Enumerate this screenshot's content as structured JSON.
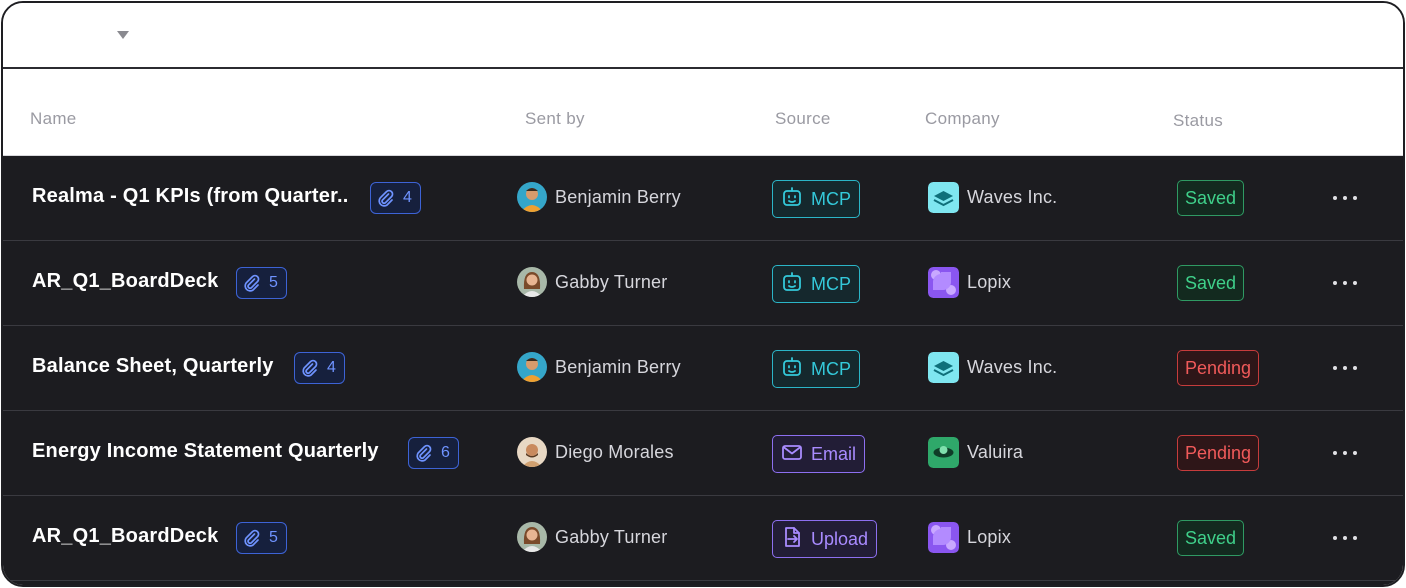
{
  "columns": {
    "name": "Name",
    "sent_by": "Sent by",
    "source": "Source",
    "company": "Company",
    "status": "Status"
  },
  "rows": [
    {
      "name": "Realma - Q1 KPIs (from Quarter..",
      "attachments": "4",
      "sender": "Benjamin Berry",
      "avatar": "avatar-benjamin",
      "source": "MCP",
      "source_icon": "robot-icon",
      "company": "Waves Inc.",
      "company_logo": "waves-logo",
      "status": "Saved"
    },
    {
      "name": "AR_Q1_BoardDeck",
      "attachments": "5",
      "sender": "Gabby Turner",
      "avatar": "avatar-gabby",
      "source": "MCP",
      "source_icon": "robot-icon",
      "company": "Lopix",
      "company_logo": "lopix-logo",
      "status": "Saved"
    },
    {
      "name": "Balance Sheet, Quarterly",
      "attachments": "4",
      "sender": "Benjamin Berry",
      "avatar": "avatar-benjamin",
      "source": "MCP",
      "source_icon": "robot-icon",
      "company": "Waves Inc.",
      "company_logo": "waves-logo",
      "status": "Pending"
    },
    {
      "name": "Energy Income Statement Quarterly",
      "attachments": "6",
      "sender": "Diego Morales",
      "avatar": "avatar-diego",
      "source": "Email",
      "source_icon": "envelope-icon",
      "company": "Valuira",
      "company_logo": "valuira-logo",
      "status": "Pending"
    },
    {
      "name": "AR_Q1_BoardDeck",
      "attachments": "5",
      "sender": "Gabby Turner",
      "avatar": "avatar-gabby",
      "source": "Upload",
      "source_icon": "upload-file-icon",
      "company": "Lopix",
      "company_logo": "lopix-logo",
      "status": "Saved"
    }
  ],
  "colors": {
    "row_bg": "#1c1c20",
    "attachment_accent": "#6f93ff",
    "mcp_accent": "#34c9da",
    "email_upload_accent": "#a98bff",
    "saved": "#3fd08a",
    "pending": "#f05a5a"
  }
}
